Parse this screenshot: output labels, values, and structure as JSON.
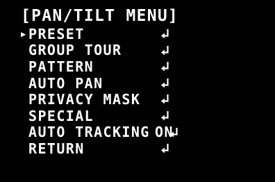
{
  "menu": {
    "title": "[PAN/TILT MENU]",
    "cursor_glyph": "▶",
    "enter_icon": "enter-return-icon",
    "text_color": "#ffffff",
    "background_color": "#000000",
    "items": [
      {
        "label": "PRESET",
        "value": "",
        "selected": true
      },
      {
        "label": "GROUP TOUR",
        "value": "",
        "selected": false
      },
      {
        "label": "PATTERN",
        "value": "",
        "selected": false
      },
      {
        "label": "AUTO PAN",
        "value": "",
        "selected": false
      },
      {
        "label": "PRIVACY MASK",
        "value": "",
        "selected": false
      },
      {
        "label": "SPECIAL",
        "value": "",
        "selected": false
      },
      {
        "label": "AUTO TRACKING",
        "value": "ON",
        "selected": false
      },
      {
        "label": "RETURN",
        "value": "",
        "selected": false
      }
    ]
  }
}
